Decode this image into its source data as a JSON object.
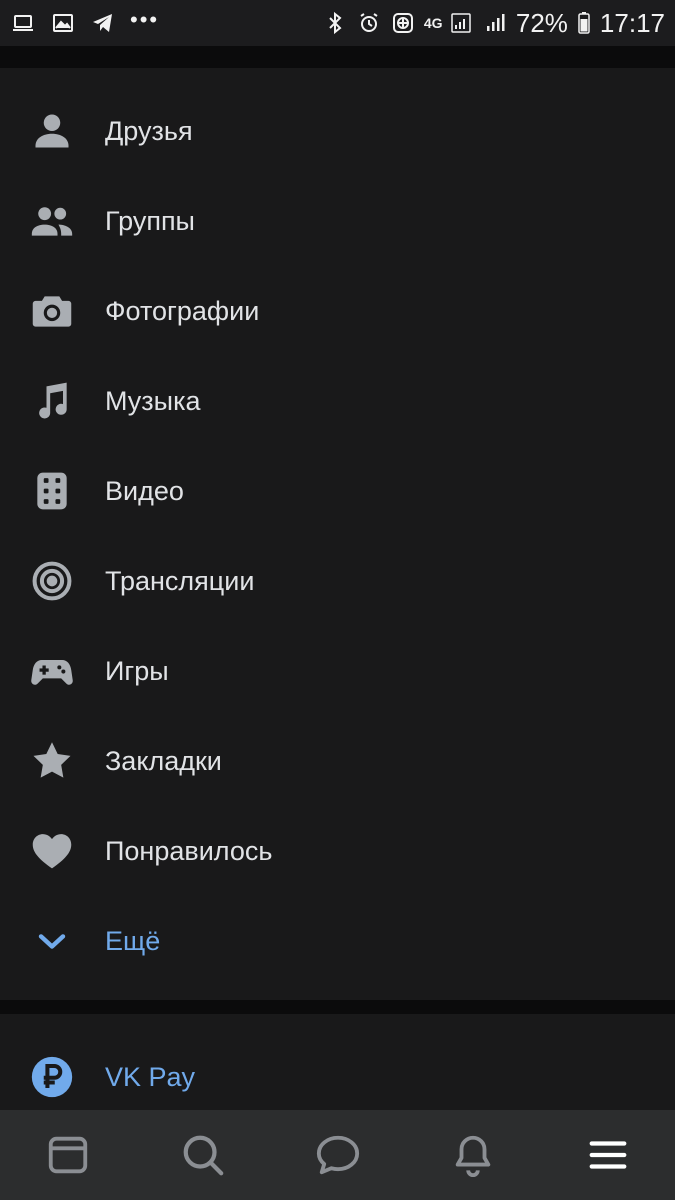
{
  "status_bar": {
    "battery": "72%",
    "time": "17:17",
    "network": "4G",
    "left_icons": [
      "laptop-icon",
      "image-icon",
      "telegram-icon",
      "more-dots-icon"
    ],
    "right_icons": [
      "bluetooth-icon",
      "alarm-icon",
      "vpn-globe-icon",
      "signal-icon",
      "battery-icon"
    ]
  },
  "menu": {
    "items": [
      {
        "label": "Друзья",
        "icon": "person-icon"
      },
      {
        "label": "Группы",
        "icon": "people-icon"
      },
      {
        "label": "Фотографии",
        "icon": "camera-icon"
      },
      {
        "label": "Музыка",
        "icon": "music-note-icon"
      },
      {
        "label": "Видео",
        "icon": "video-film-icon"
      },
      {
        "label": "Трансляции",
        "icon": "broadcast-icon"
      },
      {
        "label": "Игры",
        "icon": "gamepad-icon"
      },
      {
        "label": "Закладки",
        "icon": "star-icon"
      },
      {
        "label": "Понравилось",
        "icon": "heart-icon"
      }
    ],
    "more": {
      "label": "Ещё",
      "icon": "chevron-down-icon"
    },
    "vkpay": {
      "label": "VK Pay",
      "icon": "ruble-icon"
    }
  },
  "tabbar": {
    "tabs": [
      "news-tab",
      "search-tab",
      "messages-tab",
      "notifications-tab",
      "menu-tab"
    ],
    "active": "menu-tab"
  },
  "colors": {
    "background": "#0b0b0c",
    "card": "#19191a",
    "tabbar": "#2c2d2e",
    "text": "#e1e3e6",
    "icon": "#aaaeb3",
    "accent": "#71aaeb"
  }
}
